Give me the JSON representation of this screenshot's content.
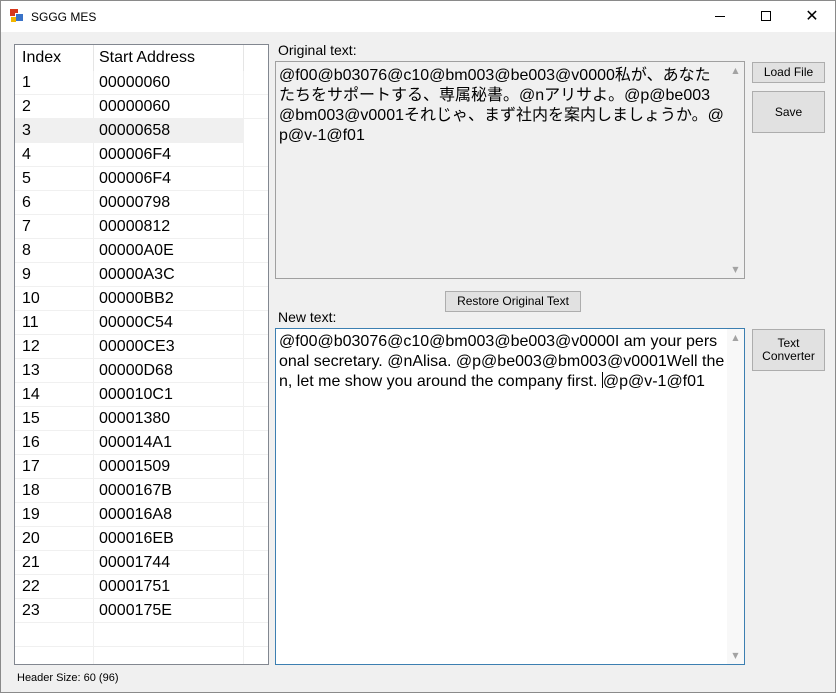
{
  "window": {
    "title": "SGGG MES",
    "close_glyph": "✕"
  },
  "list": {
    "headers": [
      "Index",
      "Start Address"
    ],
    "selected_index": 2,
    "rows": [
      {
        "index": "1",
        "address": "00000060"
      },
      {
        "index": "2",
        "address": "00000060"
      },
      {
        "index": "3",
        "address": "00000658"
      },
      {
        "index": "4",
        "address": "000006F4"
      },
      {
        "index": "5",
        "address": "000006F4"
      },
      {
        "index": "6",
        "address": "00000798"
      },
      {
        "index": "7",
        "address": "00000812"
      },
      {
        "index": "8",
        "address": "00000A0E"
      },
      {
        "index": "9",
        "address": "00000A3C"
      },
      {
        "index": "10",
        "address": "00000BB2"
      },
      {
        "index": "11",
        "address": "00000C54"
      },
      {
        "index": "12",
        "address": "00000CE3"
      },
      {
        "index": "13",
        "address": "00000D68"
      },
      {
        "index": "14",
        "address": "000010C1"
      },
      {
        "index": "15",
        "address": "00001380"
      },
      {
        "index": "16",
        "address": "000014A1"
      },
      {
        "index": "17",
        "address": "00001509"
      },
      {
        "index": "18",
        "address": "0000167B"
      },
      {
        "index": "19",
        "address": "000016A8"
      },
      {
        "index": "20",
        "address": "000016EB"
      },
      {
        "index": "21",
        "address": "00001744"
      },
      {
        "index": "22",
        "address": "00001751"
      },
      {
        "index": "23",
        "address": "0000175E"
      }
    ]
  },
  "original": {
    "label": "Original text:",
    "text": "@f00@b03076@c10@bm003@be003@v0000私が、あなたたちをサポートする、専属秘書。@nアリサよ。@p@be003@bm003@v0001それじゃ、まず社内を案内しましょうか。@p@v-1@f01"
  },
  "new_text": {
    "label": "New text:",
    "text_before_caret": "@f00@b03076@c10@bm003@be003@v0000I am your personal secretary. @nAlisa. @p@be003@bm003@v0001Well then, let me show you around the company first. ",
    "text_after_caret": "@p@v-1@f01"
  },
  "buttons": {
    "load_file": "Load File",
    "save": "Save",
    "restore": "Restore Original Text",
    "converter_line1": "Text",
    "converter_line2": "Converter"
  },
  "scroll": {
    "up_glyph": "▲",
    "down_glyph": "▼"
  },
  "status": {
    "header_size": "Header Size: 60 (96)"
  }
}
